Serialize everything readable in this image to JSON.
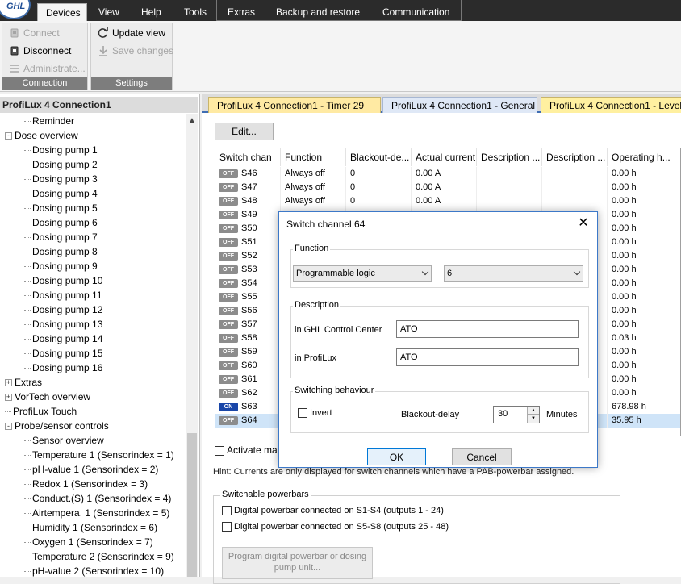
{
  "ribbon": {
    "logo": "GHL",
    "tabs": [
      "Devices",
      "View",
      "Help",
      "Tools",
      "Extras",
      "Backup and restore",
      "Communication"
    ],
    "active_tab": "Devices",
    "groups": [
      {
        "label": "Connection",
        "buttons": [
          {
            "label": "Connect",
            "icon": "plug-icon",
            "enabled": false
          },
          {
            "label": "Disconnect",
            "icon": "unplug-icon",
            "enabled": true
          },
          {
            "label": "Administrate...",
            "icon": "list-icon",
            "enabled": false
          }
        ]
      },
      {
        "label": "Settings",
        "buttons": [
          {
            "label": "Update view",
            "icon": "refresh-icon",
            "enabled": true
          },
          {
            "label": "Save changes",
            "icon": "download-icon",
            "enabled": false
          }
        ]
      }
    ]
  },
  "tree": {
    "header": "ProfiLux 4 Connection1",
    "items": [
      {
        "label": "Reminder",
        "level": 2
      },
      {
        "label": "Dose overview",
        "level": 1,
        "expander": "-"
      },
      {
        "label": "Dosing pump 1",
        "level": 2
      },
      {
        "label": "Dosing pump 2",
        "level": 2
      },
      {
        "label": "Dosing pump 3",
        "level": 2
      },
      {
        "label": "Dosing pump 4",
        "level": 2
      },
      {
        "label": "Dosing pump 5",
        "level": 2
      },
      {
        "label": "Dosing pump 6",
        "level": 2
      },
      {
        "label": "Dosing pump 7",
        "level": 2
      },
      {
        "label": "Dosing pump 8",
        "level": 2
      },
      {
        "label": "Dosing pump 9",
        "level": 2
      },
      {
        "label": "Dosing pump 10",
        "level": 2
      },
      {
        "label": "Dosing pump 11",
        "level": 2
      },
      {
        "label": "Dosing pump 12",
        "level": 2
      },
      {
        "label": "Dosing pump 13",
        "level": 2
      },
      {
        "label": "Dosing pump 14",
        "level": 2
      },
      {
        "label": "Dosing pump 15",
        "level": 2
      },
      {
        "label": "Dosing pump 16",
        "level": 2
      },
      {
        "label": "Extras",
        "level": 1,
        "expander": "+"
      },
      {
        "label": "VorTech overview",
        "level": 1,
        "expander": "+"
      },
      {
        "label": "ProfiLux Touch",
        "level": 1
      },
      {
        "label": "Probe/sensor controls",
        "level": 1,
        "expander": "-"
      },
      {
        "label": "Sensor overview",
        "level": 2
      },
      {
        "label": "Temperature 1 (Sensorindex = 1)",
        "level": 2
      },
      {
        "label": "pH-value 1 (Sensorindex = 2)",
        "level": 2
      },
      {
        "label": "Redox 1 (Sensorindex = 3)",
        "level": 2
      },
      {
        "label": "Conduct.(S) 1 (Sensorindex = 4)",
        "level": 2
      },
      {
        "label": "Airtempera. 1 (Sensorindex = 5)",
        "level": 2
      },
      {
        "label": "Humidity 1 (Sensorindex = 6)",
        "level": 2
      },
      {
        "label": "Oxygen 1 (Sensorindex = 7)",
        "level": 2
      },
      {
        "label": "Temperature 2 (Sensorindex = 9)",
        "level": 2
      },
      {
        "label": "pH-value 2 (Sensorindex = 10)",
        "level": 2
      }
    ]
  },
  "doc_tabs": [
    "ProfiLux 4 Connection1 - Timer 29",
    "ProfiLux 4 Connection1 - General",
    "ProfiLux 4 Connection1 - Level"
  ],
  "active_doc_tab": "ProfiLux 4 Connection1 - General",
  "content": {
    "edit_button": "Edit...",
    "columns": [
      "Switch chan",
      "Function",
      "Blackout-de...",
      "Actual current",
      "Description ...",
      "Description ...",
      "Operating h..."
    ],
    "rows": [
      {
        "state": "OFF",
        "channel": "S46",
        "function": "Always off",
        "blackout": "0",
        "current": "0.00 A",
        "hours": "0.00 h"
      },
      {
        "state": "OFF",
        "channel": "S47",
        "function": "Always off",
        "blackout": "0",
        "current": "0.00 A",
        "hours": "0.00 h"
      },
      {
        "state": "OFF",
        "channel": "S48",
        "function": "Always off",
        "blackout": "0",
        "current": "0.00 A",
        "hours": "0.00 h"
      },
      {
        "state": "OFF",
        "channel": "S49",
        "function": "Always off",
        "blackout": "0",
        "current": "0.00 A",
        "hours": "0.00 h"
      },
      {
        "state": "OFF",
        "channel": "S50",
        "function": "",
        "blackout": "",
        "current": "",
        "hours": "0.00 h"
      },
      {
        "state": "OFF",
        "channel": "S51",
        "function": "",
        "blackout": "",
        "current": "",
        "hours": "0.00 h"
      },
      {
        "state": "OFF",
        "channel": "S52",
        "function": "",
        "blackout": "",
        "current": "",
        "hours": "0.00 h"
      },
      {
        "state": "OFF",
        "channel": "S53",
        "function": "",
        "blackout": "",
        "current": "",
        "hours": "0.00 h"
      },
      {
        "state": "OFF",
        "channel": "S54",
        "function": "",
        "blackout": "",
        "current": "",
        "hours": "0.00 h"
      },
      {
        "state": "OFF",
        "channel": "S55",
        "function": "",
        "blackout": "",
        "current": "",
        "hours": "0.00 h"
      },
      {
        "state": "OFF",
        "channel": "S56",
        "function": "",
        "blackout": "",
        "current": "",
        "hours": "0.00 h"
      },
      {
        "state": "OFF",
        "channel": "S57",
        "function": "",
        "blackout": "",
        "current": "",
        "hours": "0.00 h"
      },
      {
        "state": "OFF",
        "channel": "S58",
        "function": "",
        "blackout": "",
        "current": "",
        "hours": "0.03 h"
      },
      {
        "state": "OFF",
        "channel": "S59",
        "function": "",
        "blackout": "",
        "current": "",
        "hours": "0.00 h"
      },
      {
        "state": "OFF",
        "channel": "S60",
        "function": "",
        "blackout": "",
        "current": "",
        "hours": "0.00 h"
      },
      {
        "state": "OFF",
        "channel": "S61",
        "function": "",
        "blackout": "",
        "current": "",
        "hours": "0.00 h"
      },
      {
        "state": "OFF",
        "channel": "S62",
        "function": "",
        "blackout": "",
        "current": "",
        "hours": "0.00 h"
      },
      {
        "state": "ON",
        "channel": "S63",
        "function": "",
        "blackout": "",
        "current": "",
        "hours": "678.98 h"
      },
      {
        "state": "OFF",
        "channel": "S64",
        "function": "",
        "blackout": "",
        "current": "",
        "hours": "35.95 h",
        "selected": true
      }
    ],
    "activate_manual": "Activate manu",
    "hint": "Hint: Currents are only displayed for switch channels which have a PAB-powerbar assigned.",
    "powerbars": {
      "legend": "Switchable powerbars",
      "option1": "Digital powerbar connected on  S1-S4 (outputs 1 - 24)",
      "option2": "Digital powerbar connected on  S5-S8 (outputs 25 - 48)",
      "program_button_line1": "Program digital powerbar or dosing",
      "program_button_line2": "pump unit..."
    }
  },
  "dialog": {
    "title": "Switch channel 64",
    "function_legend": "Function",
    "function_value": "Programmable logic",
    "function_param": "6",
    "description_legend": "Description",
    "ghl_label": "in GHL Control Center",
    "ghl_value": "ATO",
    "profilux_label": "in ProfiLux",
    "profilux_value": "ATO",
    "switching_legend": "Switching behaviour",
    "invert_label": "Invert",
    "blackout_label": "Blackout-delay",
    "blackout_value": "30",
    "minutes_label": "Minutes",
    "ok": "OK",
    "cancel": "Cancel"
  },
  "colors": {
    "accent": "#3f6db3",
    "on_toggle": "#1946a8",
    "off_toggle": "#8c8c8c",
    "selected_row": "#cfe4f8"
  }
}
